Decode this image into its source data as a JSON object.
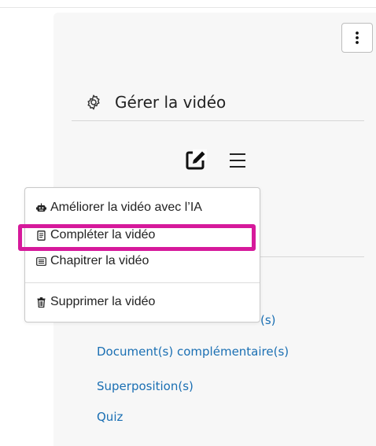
{
  "header": {
    "title": "Gérer la vidéo",
    "icon": "gear-icon"
  },
  "toolbar": {
    "edit_icon": "edit-icon",
    "menu_icon": "hamburger-icon",
    "more_icon": "kebab-menu-icon"
  },
  "dropdown": {
    "items": [
      {
        "label": "Améliorer la vidéo avec l’IA",
        "icon": "robot-icon"
      },
      {
        "label": "Compléter la vidéo",
        "icon": "document-icon"
      },
      {
        "label": "Chapitrer la vidéo",
        "icon": "chapters-icon"
      },
      {
        "label": "Supprimer la vidéo",
        "icon": "trash-icon"
      }
    ]
  },
  "links": [
    {
      "label": "(s)"
    },
    {
      "label": "Document(s) complémentaire(s)"
    },
    {
      "label": "Superposition(s)"
    },
    {
      "label": "Quiz"
    }
  ],
  "colors": {
    "highlight": "#d6199b",
    "link": "#1a6fb3",
    "panel": "#f7f7f7"
  }
}
